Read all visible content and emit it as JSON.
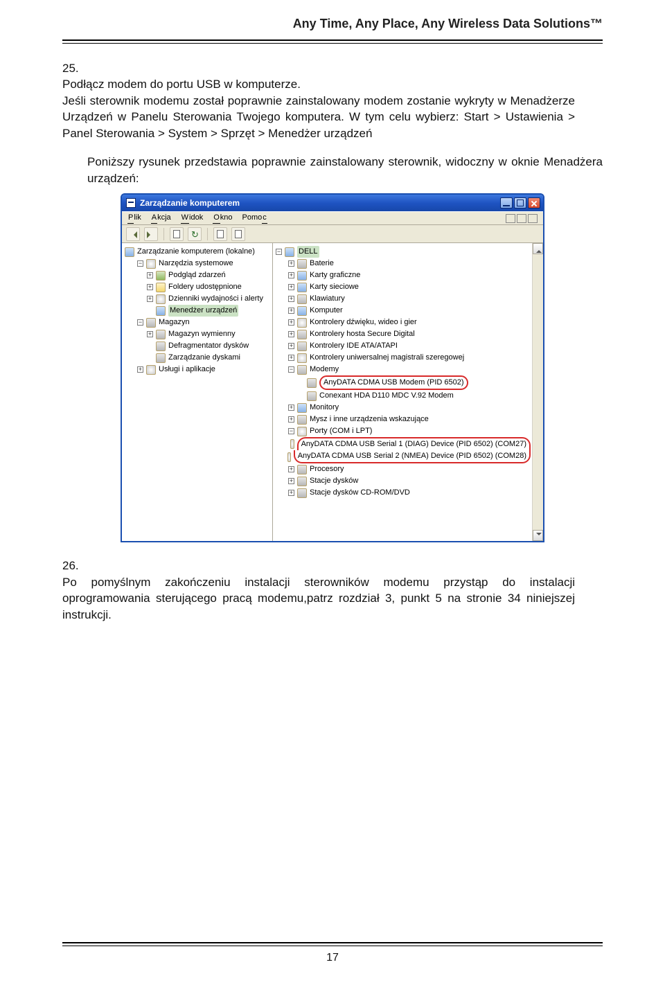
{
  "header": {
    "title": "Any Time, Any Place, Any Wireless Data Solutions™"
  },
  "p25": {
    "num": "25.",
    "l1": "Podłącz modem do portu USB w komputerze.",
    "l2": "Jeśli sterownik modemu został poprawnie zainstalowany modem zostanie wykryty w Menadżerze Urządzeń w Panelu Sterowania Twojego komputera. W tym celu wybierz: Start > Ustawienia > Panel Sterowania > System > Sprzęt > Menedżer urządzeń"
  },
  "caption": "Poniższy rysunek przedstawia poprawnie zainstalowany sterownik, widoczny w oknie Menadżera urządzeń:",
  "win": {
    "title": "Zarządzanie komputerem",
    "menu": {
      "plik": "Plik",
      "akcja": "Akcja",
      "widok": "Widok",
      "okno": "Okno",
      "pomoc": "Pomoc"
    }
  },
  "left": {
    "root": "Zarządzanie komputerem (lokalne)",
    "tools": "Narzędzia systemowe",
    "ev": "Podgląd zdarzeń",
    "shared": "Foldery udostępnione",
    "perf": "Dzienniki wydajności i alerty",
    "devmgr": "Menedżer urządzeń",
    "storage": "Magazyn",
    "remstor": "Magazyn wymienny",
    "defrag": "Defragmentator dysków",
    "diskmgmt": "Zarządzanie dyskami",
    "services": "Usługi i aplikacje"
  },
  "right": {
    "root": "DELL",
    "batteries": "Baterie",
    "gpu": "Karty graficzne",
    "nic": "Karty sieciowe",
    "kbd": "Klawiatury",
    "comp": "Komputer",
    "sound": "Kontrolery dźwięku, wideo i gier",
    "sdhost": "Kontrolery hosta Secure Digital",
    "ide": "Kontrolery IDE ATA/ATAPI",
    "usb": "Kontrolery uniwersalnej magistrali szeregowej",
    "modems": "Modemy",
    "modem1": "AnyDATA CDMA USB Modem (PID 6502)",
    "modem2": "Conexant HDA D110 MDC V.92 Modem",
    "monitors": "Monitory",
    "hid": "Mysz i inne urządzenia wskazujące",
    "ports": "Porty (COM i LPT)",
    "port1": "AnyDATA CDMA USB Serial 1 (DIAG) Device (PID 6502) (COM27)",
    "port2": "AnyDATA CDMA USB Serial 2 (NMEA) Device (PID 6502) (COM28)",
    "cpu": "Procesory",
    "disks": "Stacje dysków",
    "cdrom": "Stacje dysków CD-ROM/DVD"
  },
  "p26": {
    "num": "26.",
    "body": "Po pomyślnym zakończeniu instalacji sterowników modemu przystąp do instalacji oprogramowania sterującego pracą modemu,patrz rozdział 3, punkt 5 na stronie 34 niniejszej instrukcji."
  },
  "footer": {
    "page": "17"
  }
}
